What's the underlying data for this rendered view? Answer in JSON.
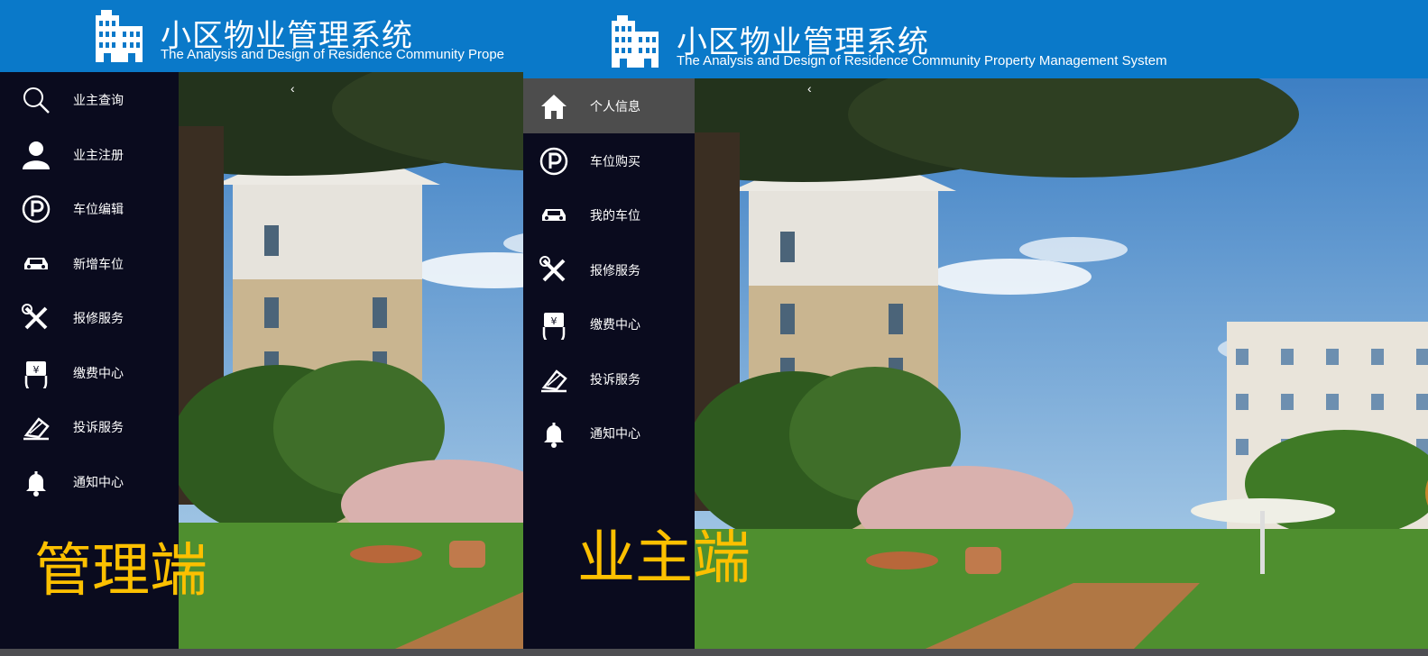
{
  "app": {
    "title": "小区物业管理系统",
    "subtitle_admin": "The Analysis and Design of Residence Community Prope",
    "subtitle_owner": "The Analysis and Design of Residence Community Property Management System"
  },
  "admin": {
    "caption": "管理端",
    "nav": [
      {
        "label": "业主查询",
        "icon": "search-icon"
      },
      {
        "label": "业主注册",
        "icon": "user-icon"
      },
      {
        "label": "车位编辑",
        "icon": "parking-icon"
      },
      {
        "label": "新增车位",
        "icon": "car-icon"
      },
      {
        "label": "报修服务",
        "icon": "tools-icon"
      },
      {
        "label": "缴费中心",
        "icon": "payment-icon"
      },
      {
        "label": "投诉服务",
        "icon": "complaint-icon"
      },
      {
        "label": "通知中心",
        "icon": "bell-icon"
      }
    ]
  },
  "owner": {
    "caption": "业主端",
    "active_item": "个人信息",
    "nav": [
      {
        "label": "个人信息",
        "icon": "home-icon"
      },
      {
        "label": "车位购买",
        "icon": "parking-icon"
      },
      {
        "label": "我的车位",
        "icon": "car-icon"
      },
      {
        "label": "报修服务",
        "icon": "tools-icon"
      },
      {
        "label": "缴费中心",
        "icon": "payment-icon"
      },
      {
        "label": "投诉服务",
        "icon": "complaint-icon"
      },
      {
        "label": "通知中心",
        "icon": "bell-icon"
      }
    ]
  },
  "collapse_arrow": "‹",
  "colors": {
    "header": "#0a79c9",
    "sidebar": "#0a0b1e",
    "active_item": "#4d4d4d",
    "caption": "#fcc000"
  }
}
